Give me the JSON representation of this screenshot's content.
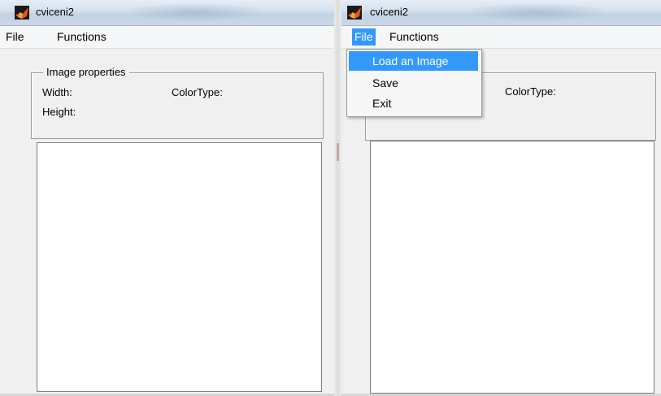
{
  "left_window": {
    "title": "cviceni2",
    "menu": {
      "file": "File",
      "functions": "Functions"
    },
    "panel": {
      "legend": "Image properties",
      "width_label": "Width:",
      "height_label": "Height:",
      "colortype_label": "ColorType:"
    }
  },
  "right_window": {
    "title": "cviceni2",
    "menu": {
      "file": "File",
      "functions": "Functions"
    },
    "panel": {
      "colortype_label": "ColorType:"
    },
    "file_menu_items": [
      "Load an Image",
      "Save",
      "Exit"
    ],
    "highlighted_item": "Load an Image"
  },
  "colors": {
    "highlight": "#3399ff",
    "titlebar": "#d3dfec",
    "window_bg": "#f0f0f0"
  },
  "icons": [
    "matlab-logo-icon"
  ]
}
